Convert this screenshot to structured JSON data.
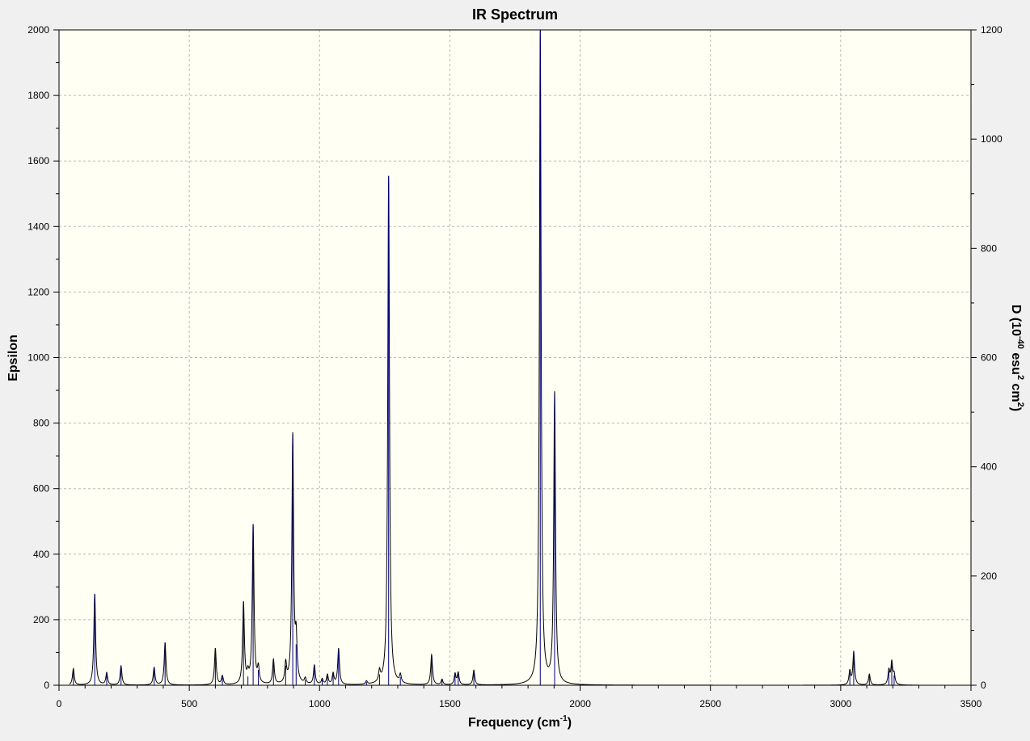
{
  "chart_data": {
    "type": "line",
    "title": "IR Spectrum",
    "xlabel_main": "Frequency (cm",
    "xlabel_sup": "-1",
    "xlabel_end": ")",
    "ylabel": "Epsilon",
    "y2label_parts": [
      {
        "t": "D (10",
        "sup": false
      },
      {
        "t": "-40",
        "sup": true
      },
      {
        "t": " esu",
        "sup": false
      },
      {
        "t": "2",
        "sup": true
      },
      {
        "t": " cm",
        "sup": false
      },
      {
        "t": "2",
        "sup": true
      },
      {
        "t": ")",
        "sup": false
      }
    ],
    "xlim": [
      0,
      3500
    ],
    "ylim": [
      0,
      2000
    ],
    "y2lim": [
      0,
      1200
    ],
    "xticks": [
      0,
      500,
      1000,
      1500,
      2000,
      2500,
      3000,
      3500
    ],
    "yticks": [
      0,
      200,
      400,
      600,
      800,
      1000,
      1200,
      1400,
      1600,
      1800,
      2000
    ],
    "y2ticks": [
      0,
      200,
      400,
      600,
      800,
      1000,
      1200
    ],
    "grid": true,
    "colors": {
      "plot_bg": "#fffff4",
      "grid": "#b8b8b8",
      "curve": "#000000",
      "stick": "#000080",
      "axis": "#000000"
    },
    "spectrum_range": [
      40,
      3300
    ],
    "linewidth_hwhm": 4,
    "sticks": [
      {
        "x": 55,
        "d": 30
      },
      {
        "x": 137,
        "d": 167
      },
      {
        "x": 183,
        "d": 22
      },
      {
        "x": 238,
        "d": 35
      },
      {
        "x": 365,
        "d": 32
      },
      {
        "x": 407,
        "d": 78
      },
      {
        "x": 600,
        "d": 67
      },
      {
        "x": 627,
        "d": 16
      },
      {
        "x": 708,
        "d": 149
      },
      {
        "x": 725,
        "d": 16
      },
      {
        "x": 745,
        "d": 291
      },
      {
        "x": 765,
        "d": 28
      },
      {
        "x": 823,
        "d": 45
      },
      {
        "x": 870,
        "d": 36
      },
      {
        "x": 897,
        "d": 455
      },
      {
        "x": 910,
        "d": 75
      },
      {
        "x": 945,
        "d": 10
      },
      {
        "x": 980,
        "d": 35
      },
      {
        "x": 1010,
        "d": 10
      },
      {
        "x": 1030,
        "d": 18
      },
      {
        "x": 1052,
        "d": 20
      },
      {
        "x": 1073,
        "d": 66
      },
      {
        "x": 1180,
        "d": 6
      },
      {
        "x": 1230,
        "d": 20
      },
      {
        "x": 1265,
        "d": 932
      },
      {
        "x": 1310,
        "d": 15
      },
      {
        "x": 1430,
        "d": 55
      },
      {
        "x": 1470,
        "d": 10
      },
      {
        "x": 1520,
        "d": 20
      },
      {
        "x": 1532,
        "d": 22
      },
      {
        "x": 1592,
        "d": 27
      },
      {
        "x": 1847,
        "d": 1199
      },
      {
        "x": 1902,
        "d": 532
      },
      {
        "x": 3035,
        "d": 25
      },
      {
        "x": 3050,
        "d": 60
      },
      {
        "x": 3110,
        "d": 20
      },
      {
        "x": 3185,
        "d": 26
      },
      {
        "x": 3196,
        "d": 40
      },
      {
        "x": 3205,
        "d": 18
      }
    ]
  }
}
